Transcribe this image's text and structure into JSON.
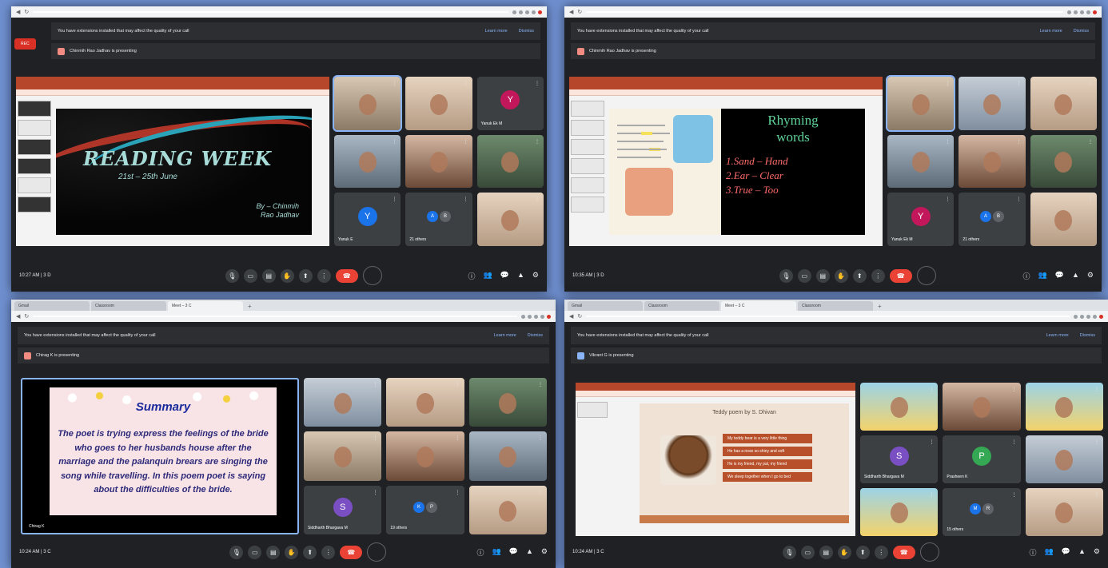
{
  "panels": {
    "p1": {
      "notice": "You have extensions installed that may affect the quality of your call",
      "learn_more": "Learn more",
      "dismiss": "Dismiss",
      "presenting": "Chinmih Rao Jadhav is presenting",
      "rec_label": "REC",
      "slide_title": "READING WEEK",
      "slide_dates": "21st – 25th June",
      "slide_by": "By – Chinmih\nRao Jadhav",
      "tiles": [
        {
          "name": "",
          "kind": "cam1"
        },
        {
          "name": "",
          "kind": "cam2"
        },
        {
          "name": "Yanuk Ek M",
          "kind": "avatar",
          "letter": "Y",
          "color": "#c2185b"
        },
        {
          "name": "",
          "kind": "cam3"
        },
        {
          "name": "",
          "kind": "cam5"
        },
        {
          "name": "",
          "kind": "cam4"
        },
        {
          "name": "Yanuk E",
          "kind": "avatar",
          "letter": "Y",
          "color": "#1a73e8"
        },
        {
          "name": "21 others",
          "kind": "others",
          "a": "A",
          "b": "B"
        },
        {
          "name": "",
          "kind": "cam2"
        }
      ],
      "time": "10:27 AM  |  3 D"
    },
    "p2": {
      "presenting": "Chinmih Rao Jadhav is presenting",
      "board_title_1": "Rhyming",
      "board_title_2": "words",
      "rhymes": [
        "1.Sand – Hand",
        "2.Ear – Clear",
        "3.True – Too"
      ],
      "tiles": [
        {
          "name": "",
          "kind": "cam1"
        },
        {
          "name": "",
          "kind": "cam6"
        },
        {
          "name": "",
          "kind": "cam2"
        },
        {
          "name": "",
          "kind": "cam3"
        },
        {
          "name": "",
          "kind": "cam5"
        },
        {
          "name": "",
          "kind": "cam4"
        },
        {
          "name": "Yanuk Ek M",
          "kind": "avatar",
          "letter": "Y",
          "color": "#c2185b"
        },
        {
          "name": "21 others",
          "kind": "others",
          "a": "A",
          "b": "B"
        },
        {
          "name": "",
          "kind": "cam2"
        }
      ],
      "time": "10:35 AM  |  3 D"
    },
    "p3": {
      "tabs": [
        "Gmail",
        "Classroom",
        "Meet – 3 C"
      ],
      "notice": "You have extensions installed that may affect the quality of your call",
      "presenting": "Chirag K is presenting",
      "summary_title": "Summary",
      "summary_body": "The poet is trying express the feelings of the bride who goes to her husbands house after the marriage and the palanquin brears are singing the song while travelling. In this poem poet is saying about the difficulties of the bride.",
      "presenter_name": "Chirag K",
      "tiles": [
        {
          "name": "",
          "kind": "cam6"
        },
        {
          "name": "",
          "kind": "cam2"
        },
        {
          "name": "",
          "kind": "cam4"
        },
        {
          "name": "",
          "kind": "cam1"
        },
        {
          "name": "",
          "kind": "cam5"
        },
        {
          "name": "",
          "kind": "cam3"
        },
        {
          "name": "Siddharth Bhargava M",
          "kind": "avatar",
          "letter": "S",
          "color": "#7b4fc4"
        },
        {
          "name": "19 others",
          "kind": "others",
          "a": "K",
          "b": "P"
        },
        {
          "name": "",
          "kind": "cam2"
        }
      ],
      "time": "10:24 AM  |  3 C"
    },
    "p4": {
      "tabs": [
        "Gmail",
        "Classroom",
        "Meet – 3 C",
        "Classroom"
      ],
      "notice": "You have extensions installed that may affect the quality of your call",
      "presenting": "Vikrant G is presenting",
      "teddy_title": "Teddy poem by S. Dhivan",
      "teddy_lines": [
        "My teddy bear is a very little thing",
        "He has a nose so shiny and soft",
        "He is my friend, my pal, my friend",
        "We sleep together when I go to bed"
      ],
      "tiles": [
        {
          "name": "",
          "kind": "cam7"
        },
        {
          "name": "",
          "kind": "cam5"
        },
        {
          "name": "",
          "kind": "cam7"
        },
        {
          "name": "Siddharth Bhargava M",
          "kind": "avatar",
          "letter": "S",
          "color": "#7b4fc4"
        },
        {
          "name": "Prasheen K",
          "kind": "avatar",
          "letter": "P",
          "color": "#34a853"
        },
        {
          "name": "",
          "kind": "cam6"
        },
        {
          "name": "",
          "kind": "cam7"
        },
        {
          "name": "15 others",
          "kind": "others",
          "a": "M",
          "b": "R"
        },
        {
          "name": "",
          "kind": "cam2"
        }
      ],
      "time": "10:24 AM  |  3 C"
    }
  },
  "colors": {
    "background": "#6f8fcf",
    "meet_dark": "#202124",
    "hangup": "#ea4335",
    "link": "#8ab4f8"
  }
}
